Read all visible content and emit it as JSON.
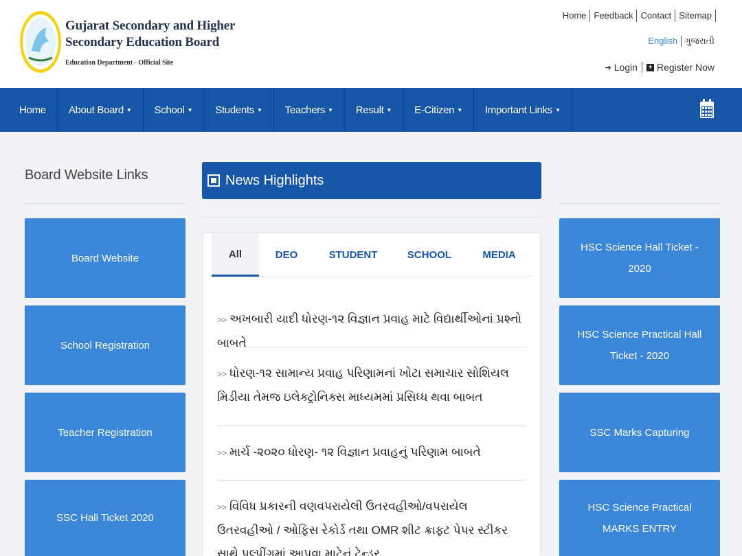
{
  "header": {
    "title_line1": "Gujarat Secondary and Higher",
    "title_line2": "Secondary Education Board",
    "subtitle": "Education Department - Official Site",
    "top_links": [
      "Home",
      "Feedback",
      "Contact",
      "Sitemap"
    ],
    "lang_english": "English",
    "lang_gujarati": "ગુજરાતી",
    "login": "Login",
    "register": "Register Now",
    "icons": {
      "login": "sign-in-icon",
      "register": "plus-square-icon",
      "calendar": "calendar-icon"
    }
  },
  "nav": {
    "items": [
      {
        "label": "Home",
        "dropdown": false
      },
      {
        "label": "About Board",
        "dropdown": true
      },
      {
        "label": "School",
        "dropdown": true
      },
      {
        "label": "Students",
        "dropdown": true
      },
      {
        "label": "Teachers",
        "dropdown": true
      },
      {
        "label": "Result",
        "dropdown": true
      },
      {
        "label": "E-Citizen",
        "dropdown": true
      },
      {
        "label": "Important Links",
        "dropdown": true
      }
    ]
  },
  "left": {
    "title": "Board Website Links",
    "tiles": [
      "Board Website",
      "School Registration",
      "Teacher Registration",
      "SSC Hall Ticket 2020"
    ]
  },
  "right": {
    "tiles": [
      "HSC Science Hall Ticket - 2020",
      "HSC Science Practical Hall Ticket - 2020",
      "SSC Marks Capturing",
      "HSC Science Practical MARKS ENTRY"
    ]
  },
  "news": {
    "title": "News Highlights",
    "tabs": [
      "All",
      "DEO",
      "STUDENT",
      "SCHOOL",
      "MEDIA"
    ],
    "active_tab": "All",
    "bullet": ">>",
    "items": [
      "અખબારી યાદી ધોરણ-૧૨ વિજ્ઞાન પ્રવાહ માટે વિદ્યાર્થીઓનાં પ્રશ્નો બાબતે",
      "ધોરણ-૧૨ સામાન્ય પ્રવાહ પરિણામનાં ખોટા સમાચાર સોશિયલ મિડીયા તેમજ ઇલેક્ટ્રોનિક્સ માધ્યમમાં પ્રસિધ્ધ થવા બાબત",
      "માર્ચ -૨૦૨૦ ધોરણ- ૧૨ વિજ્ઞાન પ્રવાહનું પરિણામ બાબતે",
      "વિવિધ પ્રકારની વણવપરાયેલી ઉતરવહીઓ/વપરાયેલ ઉતરવહીઓ / ઓફિસ રેકોર્ડ તથા OMR શીટ ક્રાફ્ટ પેપર સ્ટીકર સાથે પલ્પીંગમાં આપવા માટેનું ટેન્ડર"
    ]
  },
  "colors": {
    "nav": "#1656a8",
    "tile": "#3a86d8",
    "link": "#3a8de0",
    "background": "#f1f3f6"
  }
}
